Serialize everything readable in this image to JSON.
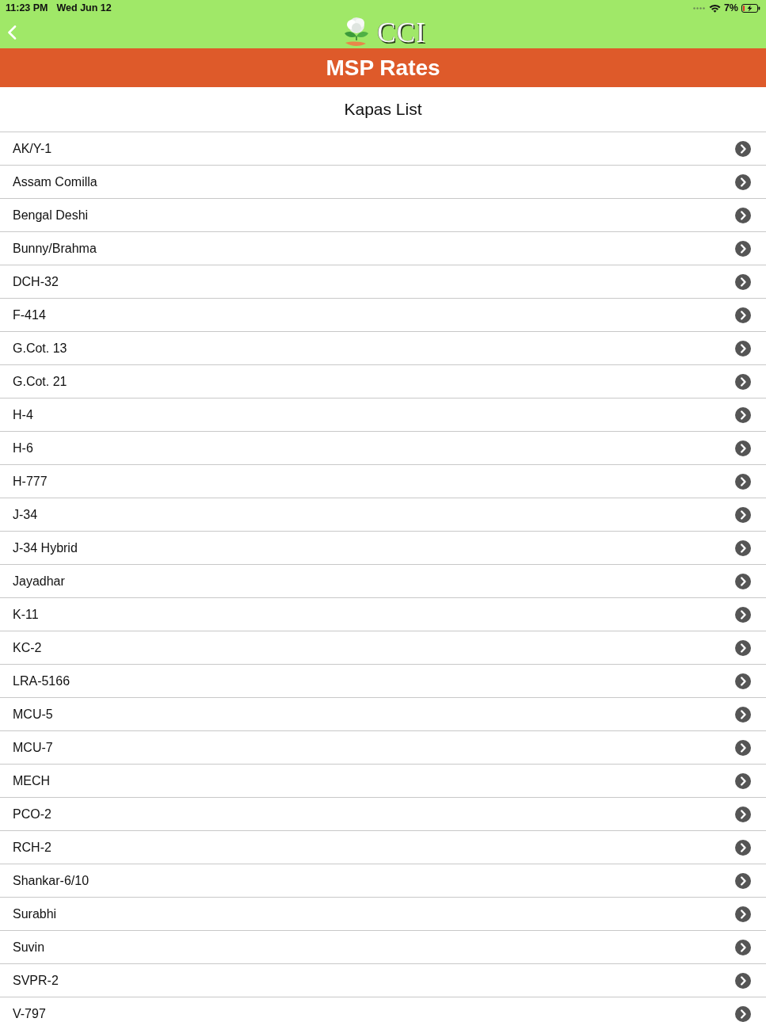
{
  "status_bar": {
    "time": "11:23 PM",
    "date": "Wed Jun 12",
    "battery": "7%"
  },
  "nav_bar": {
    "logo_text": "CCI"
  },
  "banner": {
    "title": "MSP Rates"
  },
  "list": {
    "title": "Kapas List",
    "items": [
      "AK/Y-1",
      "Assam Comilla",
      "Bengal Deshi",
      "Bunny/Brahma",
      "DCH-32",
      "F-414",
      "G.Cot. 13",
      "G.Cot. 21",
      "H-4",
      "H-6",
      "H-777",
      "J-34",
      "J-34 Hybrid",
      "Jayadhar",
      "K-11",
      "KC-2",
      "LRA-5166",
      "MCU-5",
      "MCU-7",
      "MECH",
      "PCO-2",
      "RCH-2",
      "Shankar-6/10",
      "Surabhi",
      "Suvin",
      "SVPR-2",
      "V-797"
    ]
  }
}
